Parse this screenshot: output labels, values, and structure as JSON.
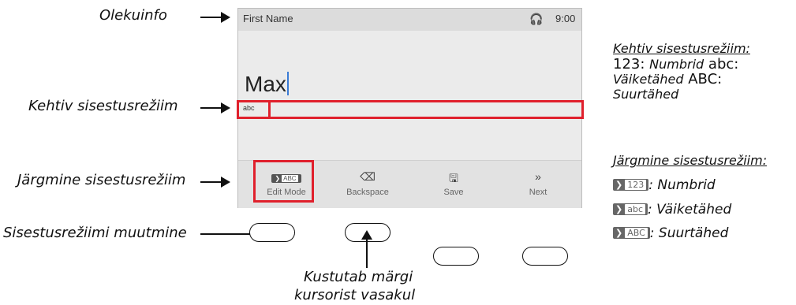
{
  "callouts": {
    "status_info": "Olekuinfo",
    "current_mode": "Kehtiv sisestusrežiim",
    "next_mode": "Järgmine sisestusrežiim",
    "change_mode": "Sisestusrežiimi muutmine",
    "delete_char_line1": "Kustutab märgi",
    "delete_char_line2": "kursorist vasakul"
  },
  "screen": {
    "title": "First Name",
    "time": "9:00",
    "input_value": "Max",
    "mode_indicator": "abc",
    "softkeys": [
      {
        "icon": "edit-mode-abc-icon",
        "icon_label": "ABC",
        "label": "Edit Mode"
      },
      {
        "icon": "backspace-icon",
        "label": "Backspace"
      },
      {
        "icon": "save-icon",
        "label": "Save"
      },
      {
        "icon": "next-icon",
        "glyph": "»",
        "label": "Next"
      }
    ]
  },
  "legend": {
    "current_heading": "Kehtiv sisestusrežiim:",
    "current_items": [
      {
        "code": "123",
        "desc": "Numbrid"
      },
      {
        "code": "abc",
        "desc": "Väiketähed"
      },
      {
        "code": "ABC",
        "desc": "Suurtähed"
      }
    ],
    "next_heading": "Järgmine sisestusrežiim:",
    "next_items": [
      {
        "code": "123",
        "desc": "Numbrid"
      },
      {
        "code": "abc",
        "desc": "Väiketähed"
      },
      {
        "code": "ABC",
        "desc": "Suurtähed"
      }
    ]
  },
  "colors": {
    "highlight": "#e0202c",
    "cursor": "#3a7bd5",
    "screen_bg": "#ebebeb"
  }
}
